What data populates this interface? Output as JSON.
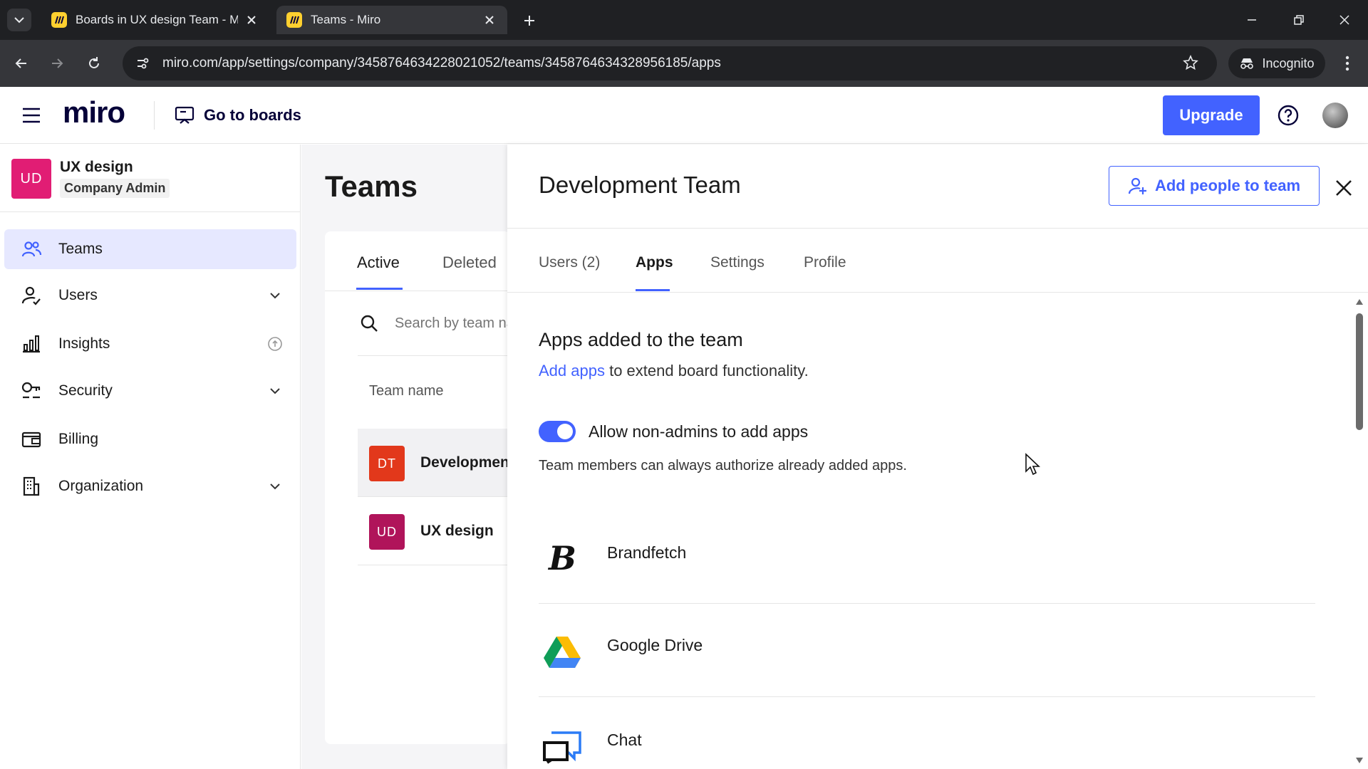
{
  "browser": {
    "tabs": [
      {
        "title": "Boards in UX design Team - Mi",
        "active": false
      },
      {
        "title": "Teams - Miro",
        "active": true
      }
    ],
    "url": "miro.com/app/settings/company/3458764634228021052/teams/3458764634328956185/apps",
    "incognito_label": "Incognito"
  },
  "header": {
    "logo": "miro",
    "goto_boards": "Go to boards",
    "upgrade": "Upgrade"
  },
  "org": {
    "badge": "UD",
    "name": "UX design",
    "role": "Company Admin"
  },
  "sidebar": {
    "items": [
      {
        "label": "Teams",
        "icon": "teams-icon",
        "active": true
      },
      {
        "label": "Users",
        "icon": "users-icon",
        "expandable": true
      },
      {
        "label": "Insights",
        "icon": "insights-icon",
        "info": true
      },
      {
        "label": "Security",
        "icon": "security-icon",
        "expandable": true
      },
      {
        "label": "Billing",
        "icon": "billing-icon"
      },
      {
        "label": "Organization",
        "icon": "organization-icon",
        "expandable": true
      }
    ]
  },
  "teams_page": {
    "title": "Teams",
    "tabs": [
      "Active",
      "Deleted"
    ],
    "search_placeholder": "Search by team name",
    "column_header": "Team name",
    "rows": [
      {
        "badge": "DT",
        "name": "Development Team",
        "color": "#e2381b"
      },
      {
        "badge": "UD",
        "name": "UX design",
        "color": "#b0145a"
      }
    ]
  },
  "panel": {
    "title": "Development Team",
    "add_people": "Add people to team",
    "tabs": [
      "Users (2)",
      "Apps",
      "Settings",
      "Profile"
    ],
    "active_tab": "Apps",
    "section_title": "Apps added to the team",
    "desc_link": "Add apps",
    "desc_rest": " to extend board functionality.",
    "toggle": {
      "label": "Allow non-admins to add apps",
      "on": true
    },
    "toggle_help": "Team members can always authorize already added apps.",
    "apps": [
      {
        "name": "Brandfetch",
        "icon": "brandfetch-icon"
      },
      {
        "name": "Google Drive",
        "icon": "google-drive-icon"
      },
      {
        "name": "Chat",
        "icon": "chat-icon"
      }
    ]
  },
  "colors": {
    "accent": "#4262ff",
    "org_badge": "#e11d74",
    "active_nav_bg": "#e6e8ff"
  }
}
